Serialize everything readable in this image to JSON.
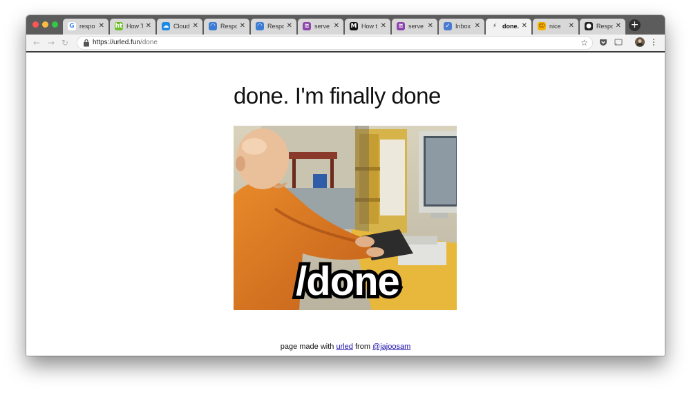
{
  "browser": {
    "tabs": [
      {
        "label": "respo",
        "icon": "google-icon",
        "color": "#ffffff",
        "glyph": "G",
        "glyph_color": "#4285f4"
      },
      {
        "label": "How T",
        "icon": "howto-icon",
        "color": "#6fbf2a",
        "glyph": "ht",
        "glyph_color": "#ffffff"
      },
      {
        "label": "Cloud",
        "icon": "cloud-icon",
        "color": "#1e88e5",
        "glyph": "☁",
        "glyph_color": "#ffffff"
      },
      {
        "label": "Respo",
        "icon": "doc-icon",
        "color": "#3b7bd4",
        "glyph": "◠",
        "glyph_color": "#ffffff"
      },
      {
        "label": "Respo",
        "icon": "doc-icon",
        "color": "#3b7bd4",
        "glyph": "◠",
        "glyph_color": "#ffffff"
      },
      {
        "label": "serve",
        "icon": "stack-icon",
        "color": "#8e44ad",
        "glyph": "≋",
        "glyph_color": "#ffffff"
      },
      {
        "label": "How t",
        "icon": "medium-icon",
        "color": "#111111",
        "glyph": "M",
        "glyph_color": "#ffffff"
      },
      {
        "label": "serve",
        "icon": "stack-icon",
        "color": "#8e44ad",
        "glyph": "≋",
        "glyph_color": "#ffffff"
      },
      {
        "label": "Inbox",
        "icon": "inbox-icon",
        "color": "#4a7bd0",
        "glyph": "✓",
        "glyph_color": "#ffffff"
      },
      {
        "label": "done.",
        "icon": "lightning-icon",
        "color": "#f2f2f2",
        "glyph": "⚡",
        "glyph_color": "#333333",
        "active": true
      },
      {
        "label": "nice",
        "icon": "emoji-icon",
        "color": "#f4b400",
        "glyph": "☺",
        "glyph_color": "#7a3b00"
      },
      {
        "label": "Respo",
        "icon": "github-icon",
        "color": "#222222",
        "glyph": "●",
        "glyph_color": "#ffffff"
      }
    ],
    "close_glyph": "✕",
    "new_tab_glyph": "+",
    "nav": {
      "back": "←",
      "forward": "→",
      "reload": "↻"
    },
    "url": {
      "host": "https://urled.fun",
      "path": "/done"
    },
    "bookmark_glyph": "☆"
  },
  "page": {
    "headline": "done. I'm finally done",
    "meme_caption": "/done",
    "footer": {
      "prefix": "page made with ",
      "link1": "urled",
      "middle": " from ",
      "link2": "@jajoosam"
    }
  }
}
